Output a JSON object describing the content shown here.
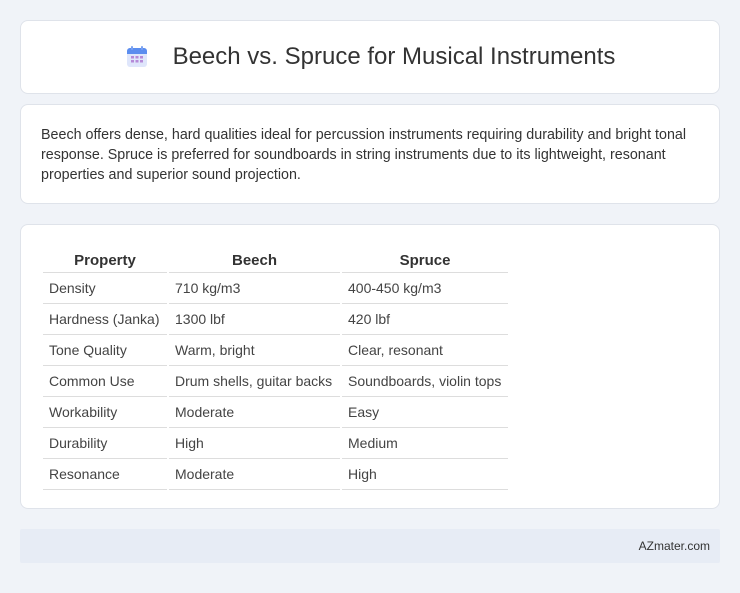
{
  "header": {
    "title": "Beech vs. Spruce for Musical Instruments",
    "icon": "calendar-icon"
  },
  "description": "Beech offers dense, hard qualities ideal for percussion instruments requiring durability and bright tonal response. Spruce is preferred for soundboards in string instruments due to its lightweight, resonant properties and superior sound projection.",
  "table": {
    "headers": [
      "Property",
      "Beech",
      "Spruce"
    ],
    "rows": [
      [
        "Density",
        "710 kg/m3",
        "400-450 kg/m3"
      ],
      [
        "Hardness (Janka)",
        "1300 lbf",
        "420 lbf"
      ],
      [
        "Tone Quality",
        "Warm, bright",
        "Clear, resonant"
      ],
      [
        "Common Use",
        "Drum shells, guitar backs",
        "Soundboards, violin tops"
      ],
      [
        "Workability",
        "Moderate",
        "Easy"
      ],
      [
        "Durability",
        "High",
        "Medium"
      ],
      [
        "Resonance",
        "Moderate",
        "High"
      ]
    ]
  },
  "footer": {
    "text": "AZmater.com"
  },
  "colors": {
    "background": "#f0f3f8",
    "card": "#ffffff",
    "footer": "#e7ecf5",
    "icon_top": "#5b8def",
    "icon_body": "#dfe6fb"
  }
}
